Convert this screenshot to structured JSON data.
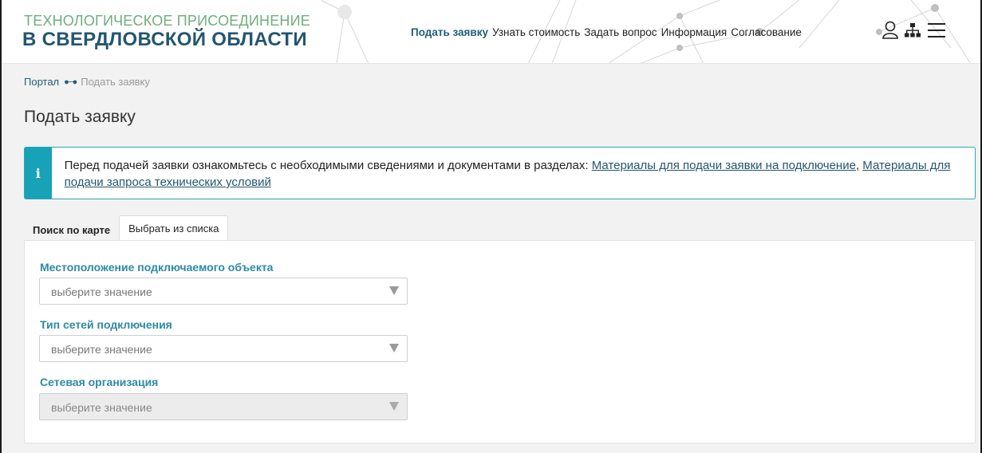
{
  "header": {
    "logo_top": "ТЕХНОЛОГИЧЕСКОЕ ПРИСОЕДИНЕНИЕ",
    "logo_bottom": "В СВЕРДЛОВСКОЙ ОБЛАСТИ",
    "nav": [
      {
        "label": "Подать заявку",
        "active": true
      },
      {
        "label": "Узнать стоимость"
      },
      {
        "label": "Задать вопрос"
      },
      {
        "label": "Информация"
      },
      {
        "label": "Согласование"
      }
    ],
    "icons": [
      "user-icon",
      "sitemap-icon",
      "menu-icon"
    ]
  },
  "breadcrumb": {
    "home": "Портал",
    "current": "Подать заявку"
  },
  "page_title": "Подать заявку",
  "info": {
    "icon": "i",
    "text": "Перед подачей заявки ознакомьтесь с необходимыми сведениями и документами в разделах: ",
    "link1": "Материалы для подачи заявки на подключение",
    "sep": ", ",
    "link2": "Материалы для подачи запроса технических условий"
  },
  "tabs": [
    {
      "label": "Поиск по карте"
    },
    {
      "label": "Выбрать из списка",
      "selected": true
    }
  ],
  "form": {
    "location_label": "Местоположение подключаемого объекта",
    "location_placeholder": "выберите значение",
    "network_type_label": "Тип сетей подключения",
    "network_type_placeholder": "выберите значение",
    "org_label": "Сетевая организация",
    "org_placeholder": "выберите значение"
  },
  "colors": {
    "accent": "#1f5d7a",
    "label": "#2d8aa5",
    "info": "#17a2b8",
    "logo_green": "#6fae7e"
  }
}
